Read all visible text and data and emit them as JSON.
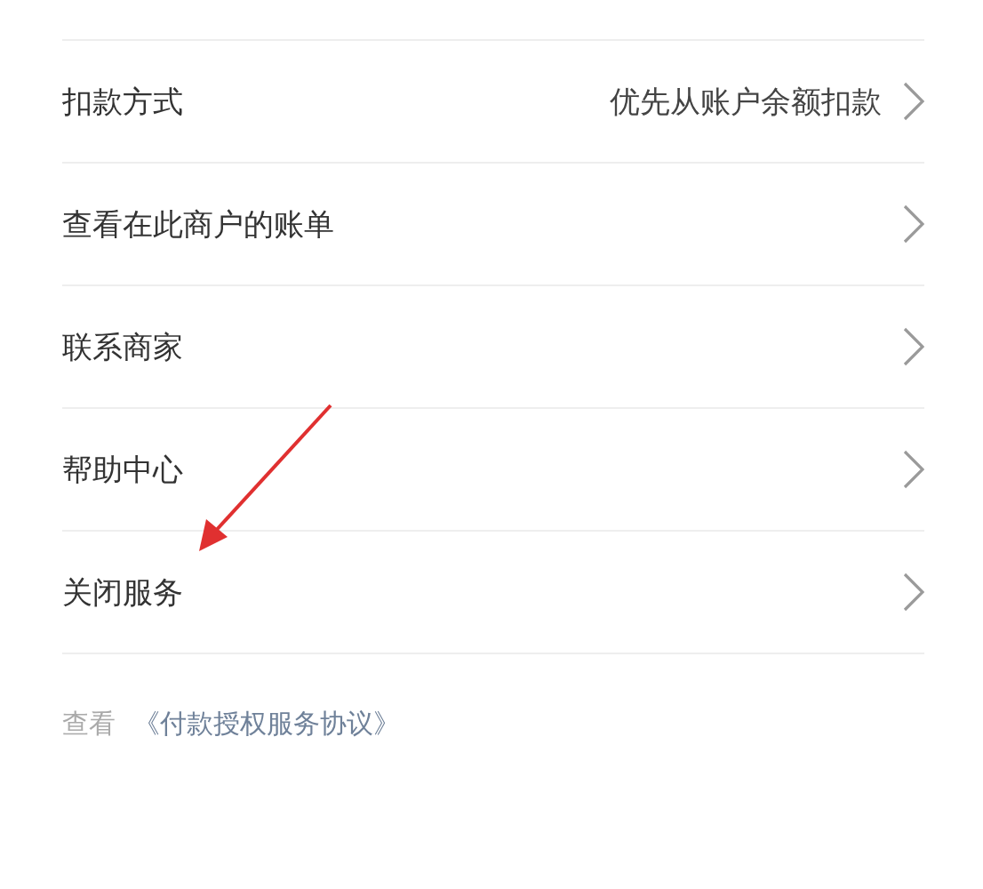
{
  "rows": [
    {
      "label": "扣款方式",
      "value": "优先从账户余额扣款"
    },
    {
      "label": "查看在此商户的账单"
    },
    {
      "label": "联系商家"
    },
    {
      "label": "帮助中心"
    },
    {
      "label": "关闭服务"
    }
  ],
  "footer": {
    "prefix": "查看",
    "link": "《付款授权服务协议》"
  }
}
